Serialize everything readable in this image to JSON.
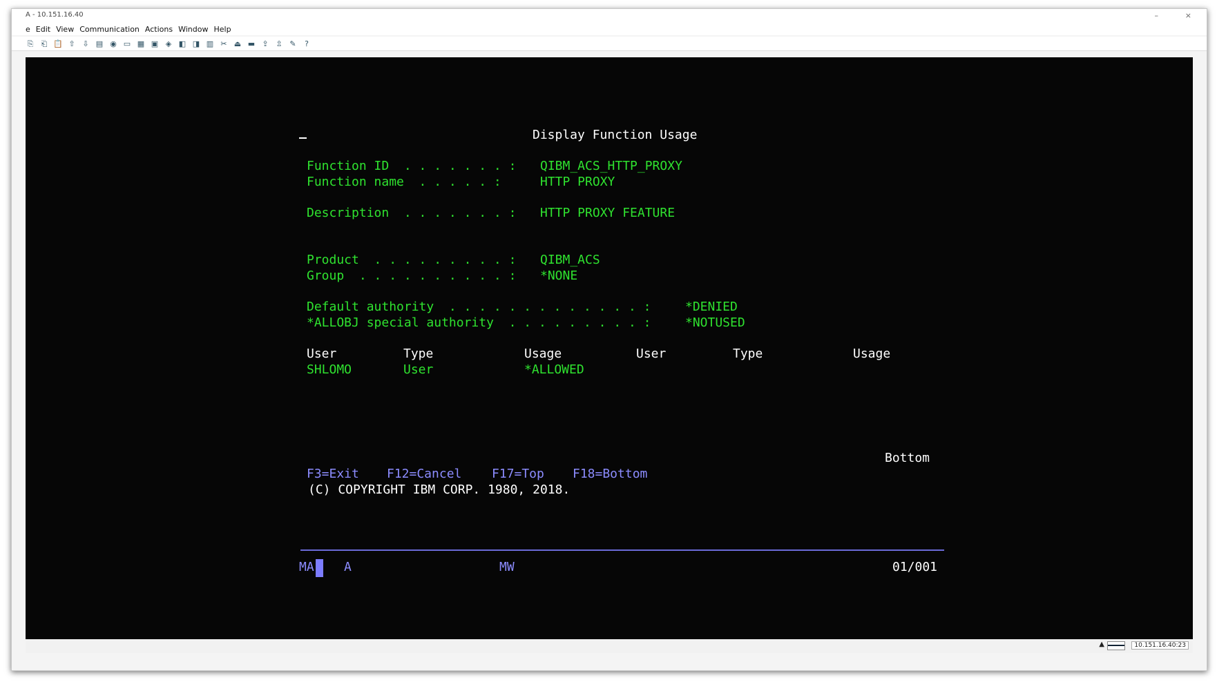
{
  "window": {
    "title": "A - 10.151.16.40",
    "controls": {
      "minimize": "–",
      "close": "×"
    }
  },
  "menu": [
    "e",
    "Edit",
    "View",
    "Communication",
    "Actions",
    "Window",
    "Help"
  ],
  "toolbar_icons": [
    "copy-icon",
    "paste-icon",
    "clipboard-icon",
    "send-file-icon",
    "receive-file-icon",
    "print-icon",
    "record-icon",
    "display-icon",
    "keypad-icon",
    "macro-icon",
    "transfer-icon",
    "settings-icon",
    "preferences-icon",
    "table-icon",
    "tools-icon",
    "disconnect-icon",
    "print-screen-icon",
    "upload-icon",
    "download-icon",
    "notes-icon",
    "help-icon"
  ],
  "toolbar_glyphs": [
    "⎘",
    "⎗",
    "📋",
    "⇧",
    "⇩",
    "▤",
    "◉",
    "▭",
    "▦",
    "▣",
    "◈",
    "◧",
    "◨",
    "▥",
    "✂",
    "⏏",
    "▬",
    "⇪",
    "⇫",
    "✎",
    "?"
  ],
  "screen": {
    "title": "Display Function Usage",
    "fields": {
      "function_id_label": "Function ID  . . . . . . . :",
      "function_id": "QIBM_ACS_HTTP_PROXY",
      "function_name_label": "Function name  . . . . . :",
      "function_name": "HTTP PROXY",
      "description_label": "Description  . . . . . . . :",
      "description": "HTTP PROXY FEATURE",
      "product_label": "Product  . . . . . . . . . :",
      "product": "QIBM_ACS",
      "group_label": "Group  . . . . . . . . . . :",
      "group": "*NONE",
      "default_authority_label": "Default authority  . . . . . . . . . . . . . :",
      "default_authority": "*DENIED",
      "allobj_label": "*ALLOBJ special authority  . . . . . . . . . :",
      "allobj": "*NOTUSED"
    },
    "columns": [
      "User",
      "Type",
      "Usage",
      "User",
      "Type",
      "Usage"
    ],
    "rows": [
      {
        "user": "SHLOMO",
        "type": "User",
        "usage": "*ALLOWED"
      }
    ],
    "more": "Bottom",
    "function_keys": [
      "F3=Exit",
      "F12=Cancel",
      "F17=Top",
      "F18=Bottom"
    ],
    "copyright": "(C) COPYRIGHT IBM CORP. 1980, 2018.",
    "oia": {
      "left": "MA",
      "mode": "A",
      "mw": "MW",
      "position": "01/001"
    }
  },
  "status": {
    "host": "10.151.16.40:23"
  }
}
